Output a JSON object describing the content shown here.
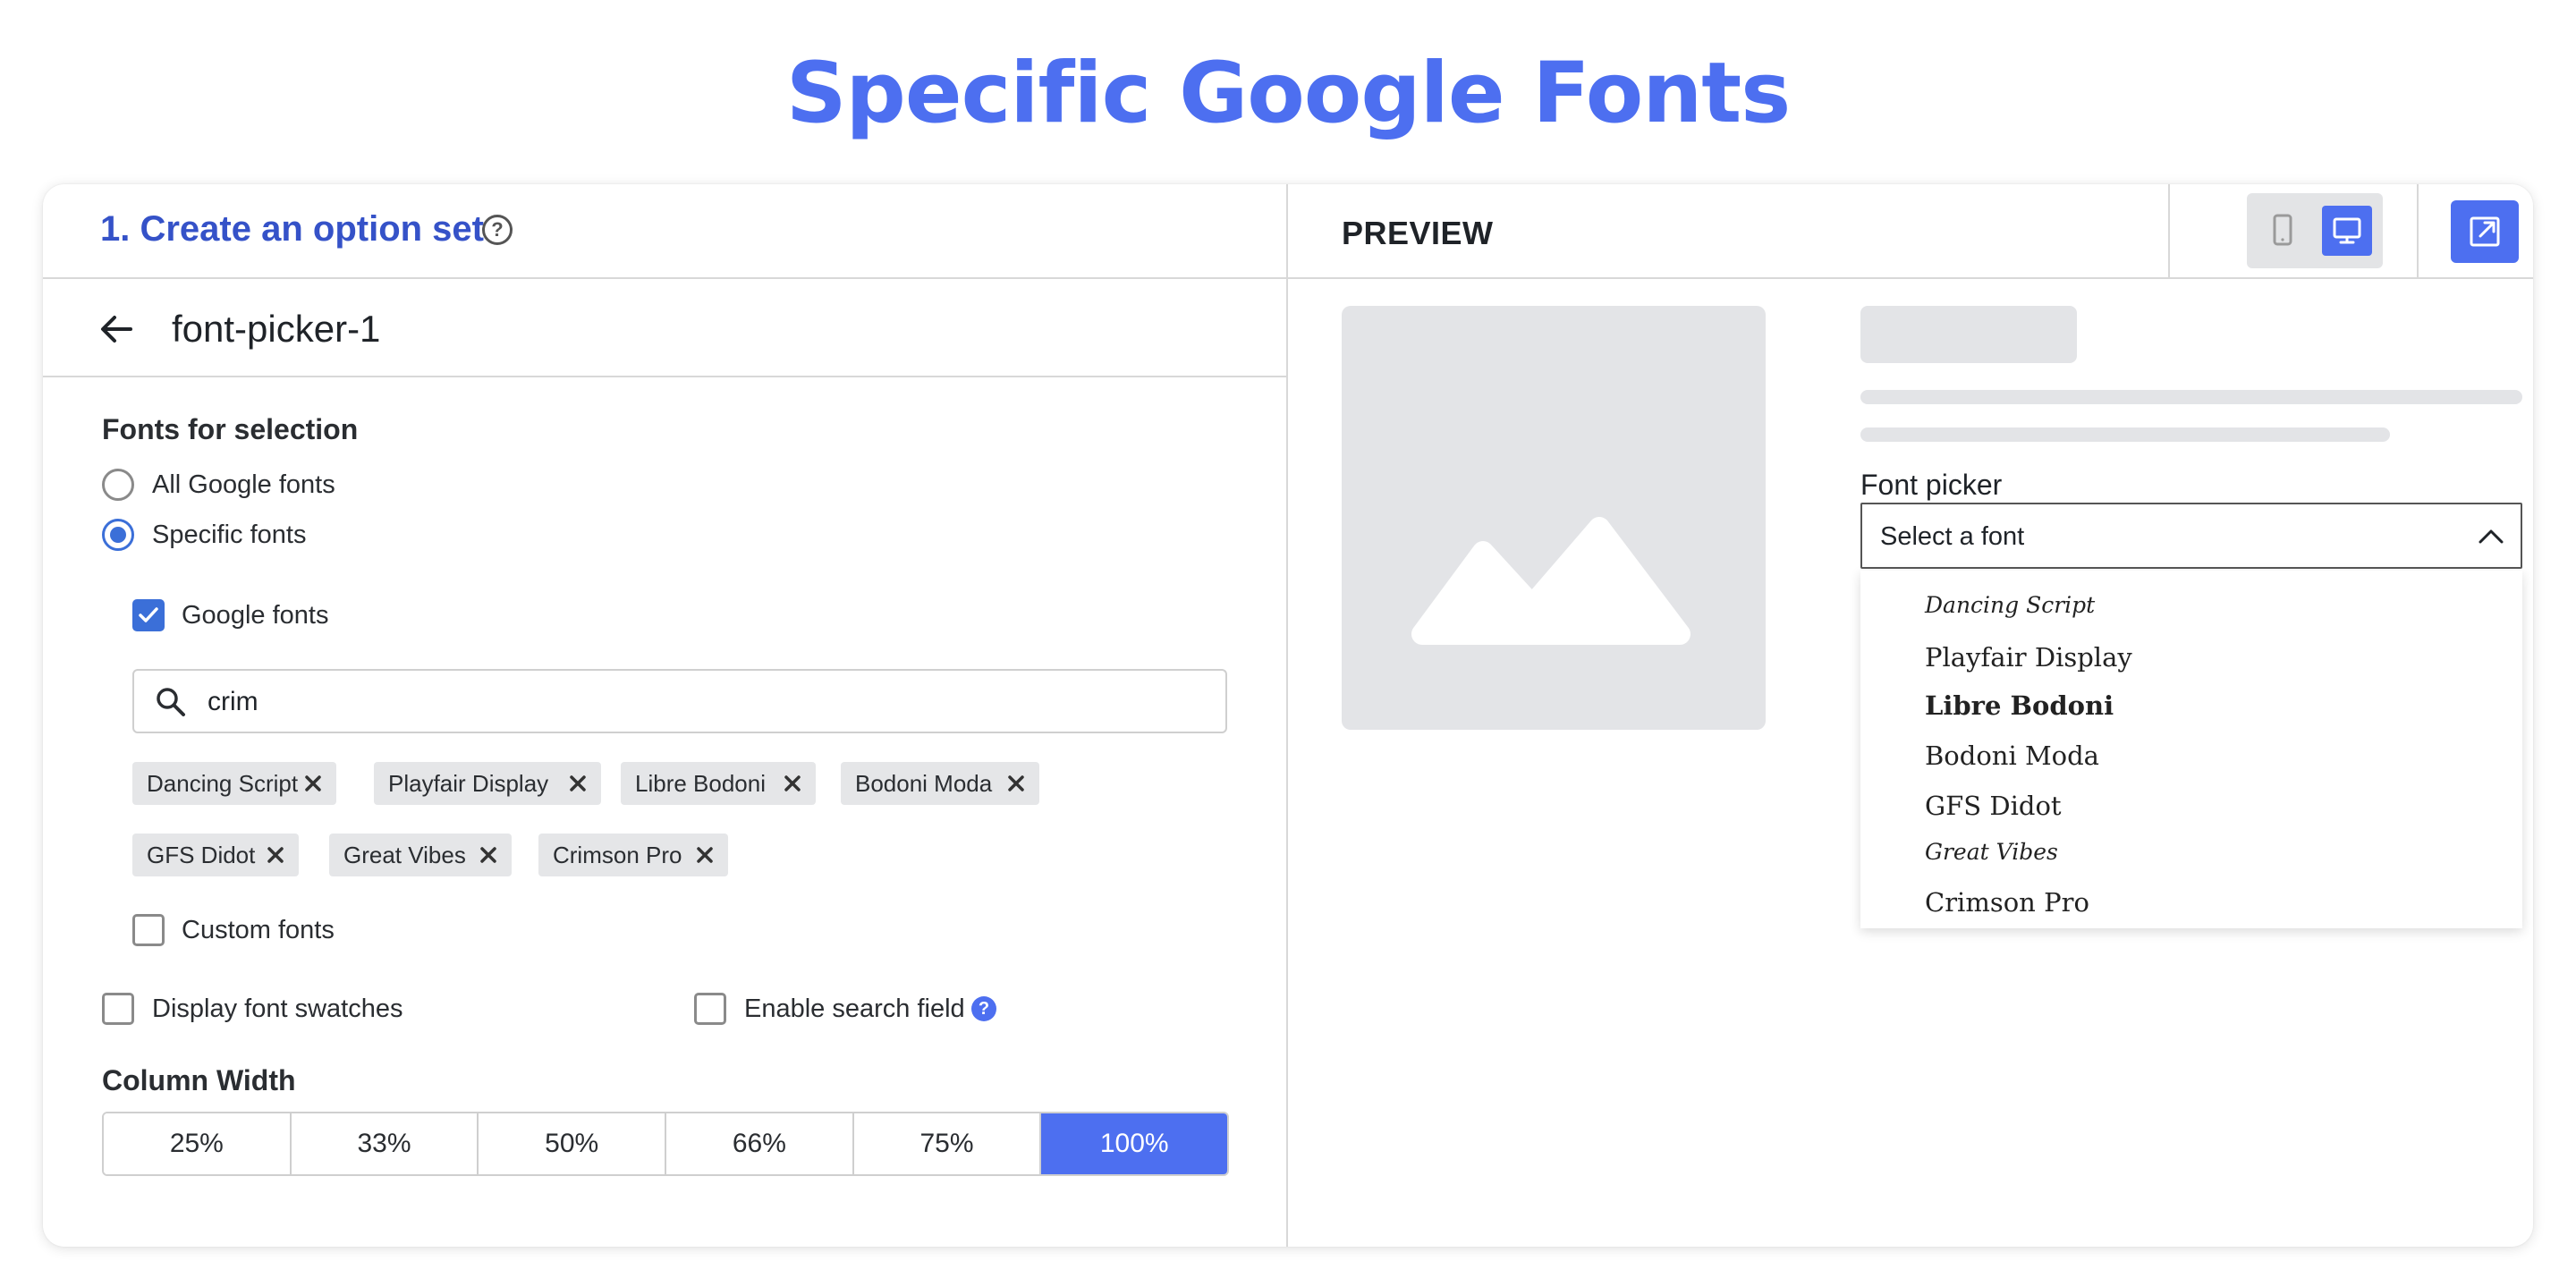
{
  "page": {
    "title": "Specific Google Fonts"
  },
  "left_panel": {
    "title": "1. Create an option set",
    "help_icon": "question-circle-icon",
    "sub_title": "font-picker-1",
    "back_icon": "arrow-left-icon",
    "fonts_section_label": "Fonts for selection",
    "radio_all_label": "All Google fonts",
    "radio_specific_label": "Specific fonts",
    "selected_radio": "Specific fonts",
    "google_fonts_label": "Google fonts",
    "google_fonts_checked": true,
    "search_value": "crim",
    "chips": [
      "Dancing Script",
      "Playfair Display",
      "Libre Bodoni",
      "Bodoni Moda",
      "GFS Didot",
      "Great Vibes",
      "Crimson Pro"
    ],
    "custom_fonts_label": "Custom fonts",
    "custom_fonts_checked": false,
    "display_swatches_label": "Display font swatches",
    "enable_search_label": "Enable search field",
    "enable_search_info": "?",
    "column_width_label": "Column Width",
    "column_widths": [
      "25%",
      "33%",
      "50%",
      "66%",
      "75%",
      "100%"
    ],
    "active_column_width": "100%"
  },
  "right_panel": {
    "preview_label": "PREVIEW",
    "device_options": [
      "mobile-icon",
      "desktop-icon"
    ],
    "active_device": "desktop-icon",
    "external_icon": "open-external-icon",
    "image_placeholder_icon": "mountain-image-icon",
    "font_picker_label": "Font picker",
    "select_placeholder": "Select a font",
    "dropdown_items": [
      "Dancing Script",
      "Playfair Display",
      "Libre Bodoni",
      "Bodoni Moda",
      "GFS Didot",
      "Great Vibes",
      "Crimson Pro"
    ]
  },
  "colors": {
    "accent": "#4d6ff0",
    "title_blue": "#3552c8",
    "check_blue": "#3b6fd8",
    "placeholder_grey": "#e3e4e7"
  }
}
